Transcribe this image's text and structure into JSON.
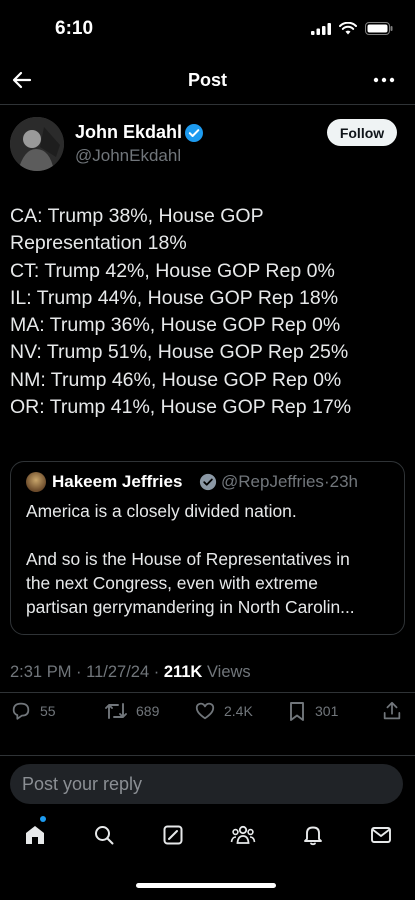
{
  "status_bar": {
    "time": "6:10"
  },
  "header": {
    "title": "Post"
  },
  "post": {
    "author_name": "John Ekdahl",
    "author_handle": "@JohnEkdahl",
    "follow_label": "Follow",
    "lines": [
      "CA: Trump 38%, House GOP",
      "Representation 18%",
      "CT: Trump 42%, House GOP Rep 0%",
      "IL: Trump 44%, House GOP Rep 18%",
      "MA: Trump 36%, House GOP Rep 0%",
      "NV: Trump 51%, House GOP Rep 25%",
      "NM: Trump 46%, House GOP Rep 0%",
      "OR: Trump 41%, House GOP Rep 17%"
    ]
  },
  "quote": {
    "author_name": "Hakeem Jeffries",
    "author_handle": "@RepJeffries",
    "time": "23h",
    "lines": [
      "America is a closely divided nation.",
      "",
      "And so is the House of Representatives in",
      "the next Congress, even with extreme",
      "partisan gerrymandering in North Carolin..."
    ]
  },
  "meta": {
    "time": "2:31 PM",
    "date": "11/27/24",
    "views_count": "211K",
    "views_label": "Views"
  },
  "actions": {
    "replies": "55",
    "reposts": "689",
    "likes": "2.4K",
    "bookmarks": "301"
  },
  "reply": {
    "placeholder": "Post your reply"
  },
  "colors": {
    "accent": "#1d9bf0",
    "background": "#000000",
    "muted": "#71767b"
  }
}
